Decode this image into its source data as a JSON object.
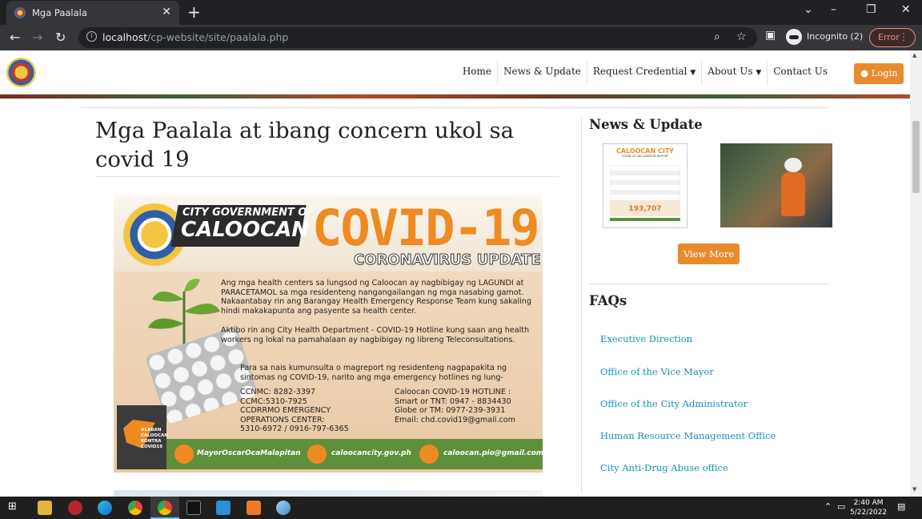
{
  "browser": {
    "tab_title": "Mga Paalala",
    "url_host": "localhost",
    "url_path": "/cp-website/site/paalala.php",
    "incognito_label": "Incognito (2)",
    "error_label": "Error"
  },
  "nav": {
    "items": [
      {
        "label": "Home"
      },
      {
        "label": "News & Update"
      },
      {
        "label": "Request Credential"
      },
      {
        "label": "About Us"
      },
      {
        "label": "Contact Us"
      }
    ],
    "login_label": "Login"
  },
  "main": {
    "title": "Mga Paalala at ibang concern ukol sa covid 19"
  },
  "poster": {
    "city_gov": "CITY GOVERNMENT OF",
    "city": "CALOOCAN",
    "covid": "COVID-19",
    "update": "CORONAVIRUS UPDATE",
    "p1": "Ang mga health centers sa lungsod ng Caloocan ay nagbibigay ng LAGUNDI at PARACETAMOL sa mga residenteng nangangailangan ng mga nasabing gamot. Nakaantabay rin ang Barangay Health Emergency Response Team kung sakaling hindi makakapunta ang pasyente sa health center.",
    "p2": "Aktibo rin ang City Health Department - COVID-19 Hotline kung saan ang health workers ng lokal na pamahalaan ay nagbibigay ng libreng Teleconsultations.",
    "p3": "Para sa nais kumunsulta o magreport ng residenteng nagpapakita ng sintomas ng COVID-19, narito ang mga emergency hotlines ng lung-",
    "left_contacts": "CCNMC: 8282-3397\nCCMC:5310-7925\nCCDRRMO EMERGENCY\nOPERATIONS CENTER:\n5310-6972 / 0916-797-6365",
    "right_contacts": "Caloocan COVID-19 HOTLINE :\nSmart or TNT: 0947 - 8834430\nGlobe or TM: 0977-239-3931\nEmail: chd.covid19@gmail.com",
    "map_label": "#LABAN\nCALOOCAN\nKONTRA\nCOVID19",
    "footer_fb": "MayorOscarOcaMalapitan",
    "footer_web": "caloocancity.gov.ph",
    "footer_mail": "caloocan.pio@gmail.com"
  },
  "sidebar": {
    "news_heading": "News & Update",
    "thumb1": {
      "city": "CALOOCAN CITY",
      "subtitle": "COVID-19 VACCINATION REPORT",
      "total": "193,707"
    },
    "view_more_label": "View More",
    "faqs_heading": "FAQs",
    "faqs": [
      {
        "label": "Executive Direction"
      },
      {
        "label": "Office of the Vice Mayor"
      },
      {
        "label": "Office of the City Administrator"
      },
      {
        "label": "Human Resource Management Office"
      },
      {
        "label": "City Anti-Drug Abuse office"
      }
    ]
  },
  "taskbar": {
    "time": "2:40 AM",
    "date": "5/22/2022"
  },
  "colors": {
    "accent": "#e88b2e",
    "link": "#1a8fb5",
    "poster_orange": "#ef8a23",
    "poster_green": "#5e8f3a"
  }
}
